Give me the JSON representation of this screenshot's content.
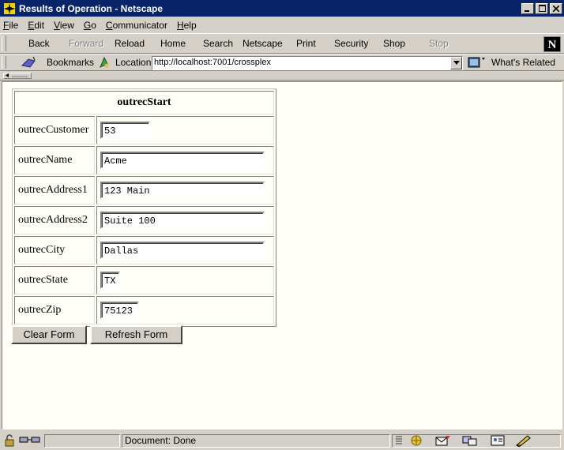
{
  "window": {
    "title": "Results of Operation - Netscape"
  },
  "menu": {
    "items": [
      "File",
      "Edit",
      "View",
      "Go",
      "Communicator",
      "Help"
    ]
  },
  "navbar": {
    "buttons": [
      {
        "label": "Back",
        "enabled": true
      },
      {
        "label": "Forward",
        "enabled": false
      },
      {
        "label": "Reload",
        "enabled": true
      },
      {
        "label": "Home",
        "enabled": true
      },
      {
        "label": "Search",
        "enabled": true
      },
      {
        "label": "Netscape",
        "enabled": true
      },
      {
        "label": "Print",
        "enabled": true
      },
      {
        "label": "Security",
        "enabled": true
      },
      {
        "label": "Shop",
        "enabled": true
      },
      {
        "label": "Stop",
        "enabled": false
      }
    ],
    "logo_letter": "N"
  },
  "location_bar": {
    "bookmarks_label": "Bookmarks",
    "location_label": "Location:",
    "url": "http://localhost:7001/crossplex",
    "whats_related_label": "What's Related"
  },
  "form": {
    "header": "outrecStart",
    "fields": [
      {
        "label": "outrecCustomer",
        "value": "53"
      },
      {
        "label": "outrecName",
        "value": "Acme"
      },
      {
        "label": "outrecAddress1",
        "value": "123 Main"
      },
      {
        "label": "outrecAddress2",
        "value": "Suite 100"
      },
      {
        "label": "outrecCity",
        "value": "Dallas"
      },
      {
        "label": "outrecState",
        "value": "TX"
      },
      {
        "label": "outrecZip",
        "value": "75123"
      }
    ],
    "clear_button": "Clear Form",
    "refresh_button": "Refresh Form"
  },
  "status": {
    "text": "Document: Done"
  },
  "colors": {
    "titlebar": "#0a246a",
    "chrome": "#d4d0c8",
    "content_bg": "#fffff8"
  }
}
